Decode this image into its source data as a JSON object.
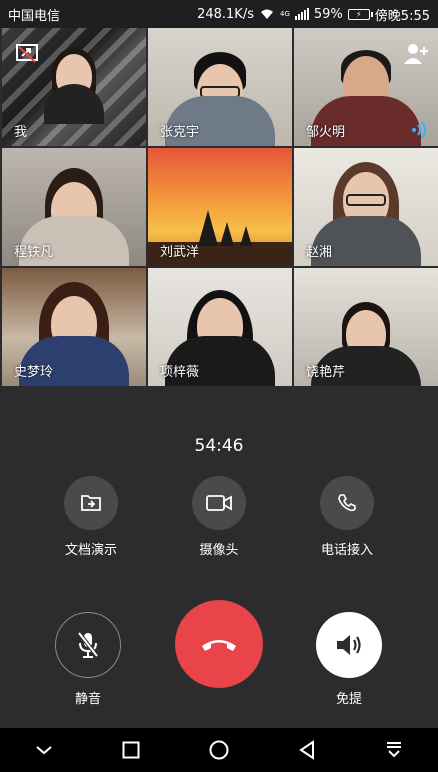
{
  "status_bar": {
    "carrier": "中国电信",
    "speed": "248.1K/s",
    "network": "4G",
    "battery": "59%",
    "time": "傍晚5:55"
  },
  "participants": [
    {
      "name": "我"
    },
    {
      "name": "张克宇"
    },
    {
      "name": "邹火明"
    },
    {
      "name": "程铁凡"
    },
    {
      "name": "刘武洋"
    },
    {
      "name": "赵湘"
    },
    {
      "name": "史梦玲"
    },
    {
      "name": "项梓薇"
    },
    {
      "name": "饶艳芹"
    }
  ],
  "call": {
    "timer": "54:46"
  },
  "controls": {
    "share_doc": "文档演示",
    "camera": "摄像头",
    "phone_join": "电话接入",
    "mute": "静音",
    "speaker": "免提"
  },
  "colors": {
    "hangup": "#e8444a",
    "speaker_active": "#ffffff",
    "button_bg": "#4a4a4c",
    "speaking_indicator": "#3ab0f2"
  },
  "icons": {
    "share_doc": "share-screen-icon",
    "camera": "video-camera-icon",
    "phone_join": "phone-icon",
    "mute": "mic-off-icon",
    "hangup": "hang-up-icon",
    "speaker": "speaker-icon"
  }
}
